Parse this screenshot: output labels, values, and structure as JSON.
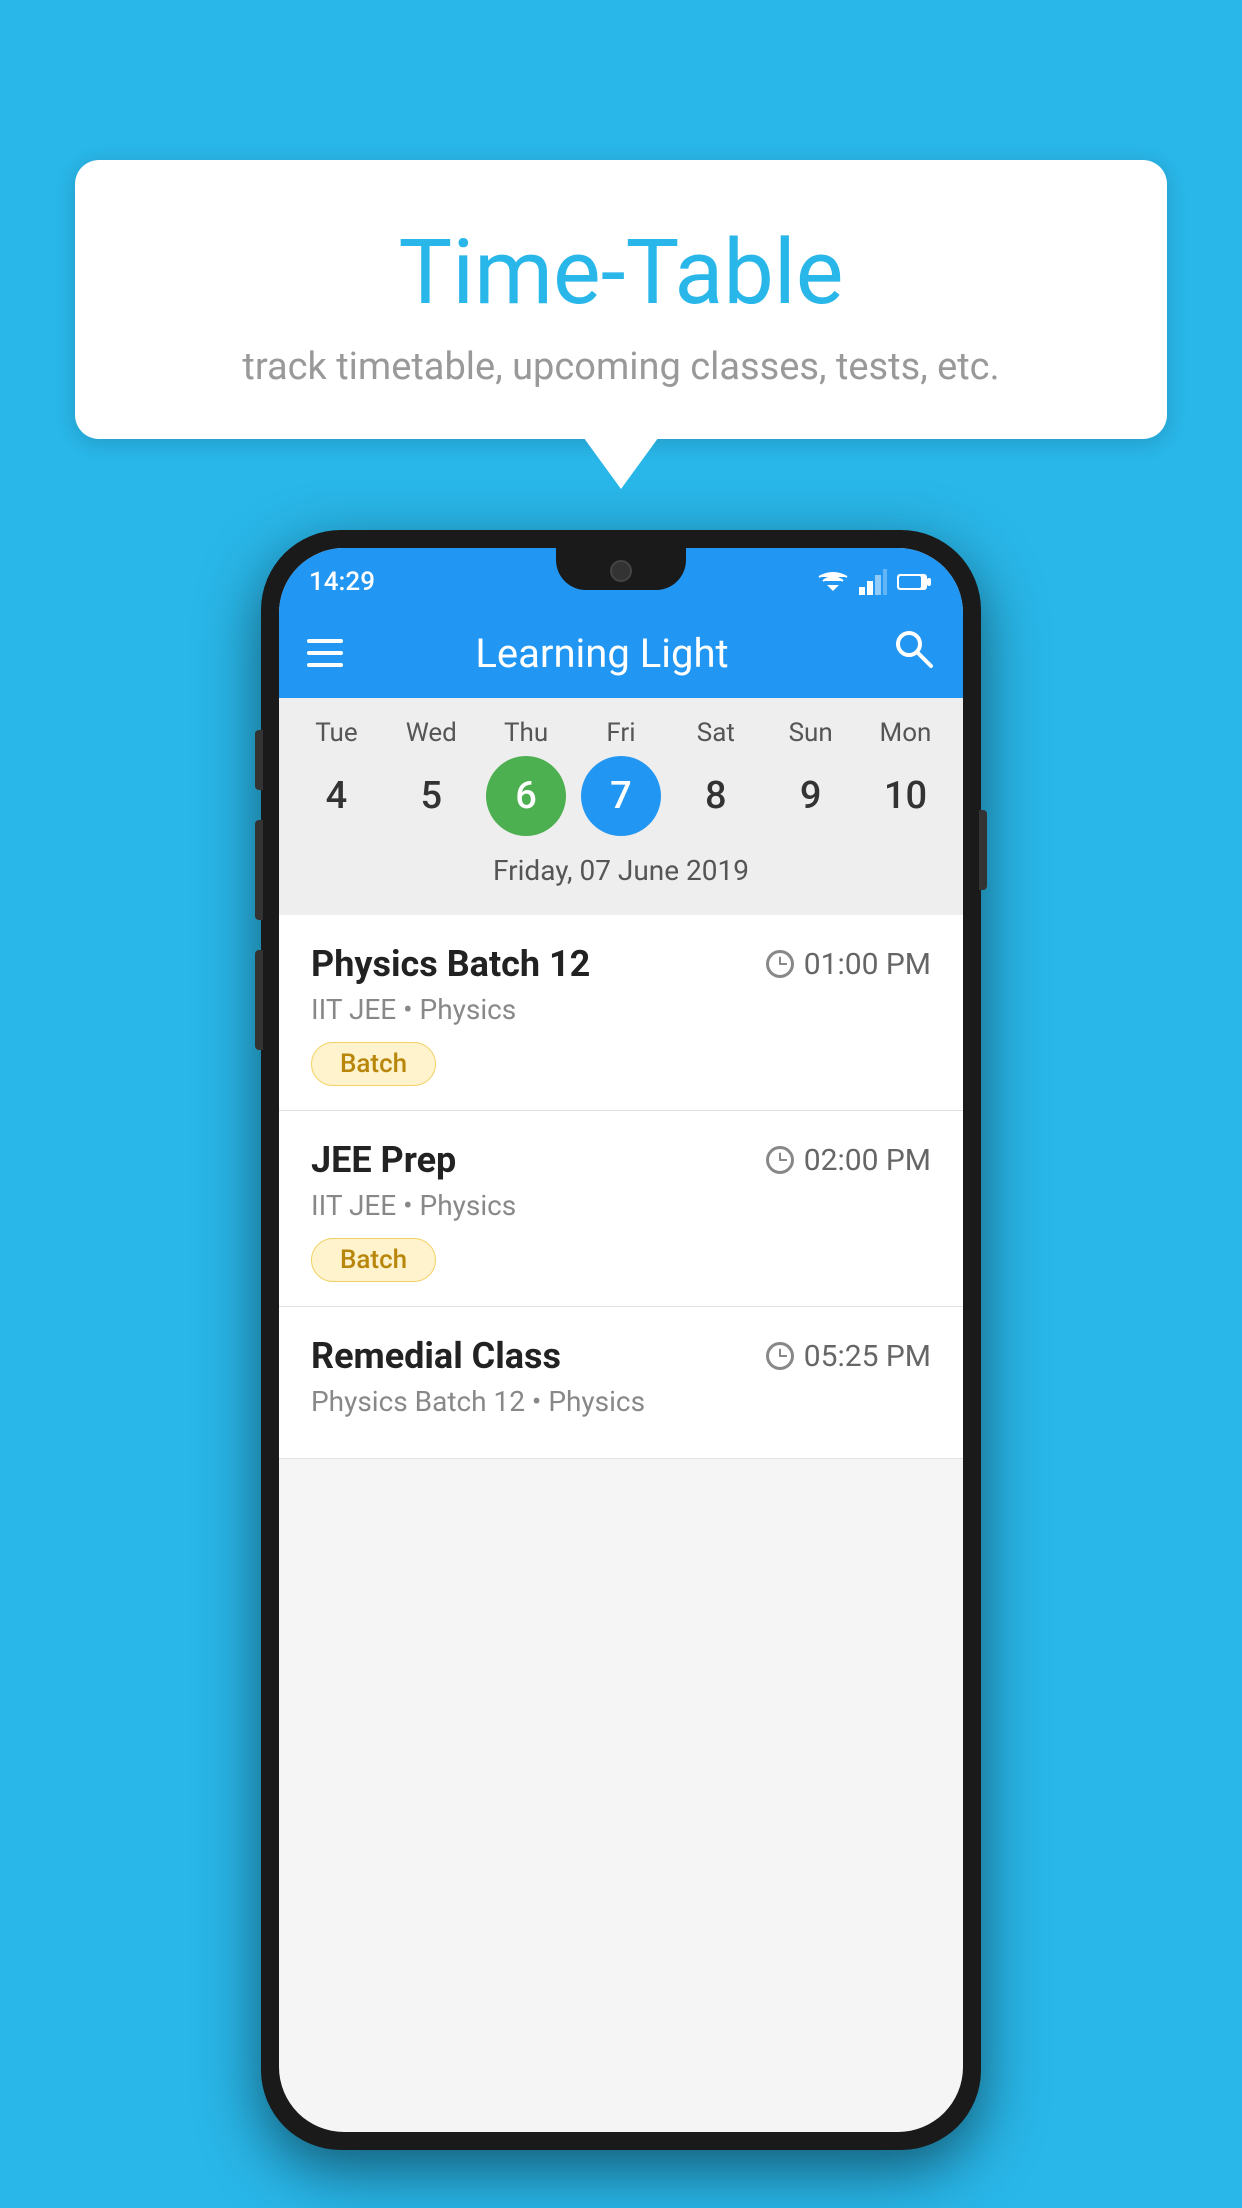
{
  "background_color": "#29B6E8",
  "bubble": {
    "title": "Time-Table",
    "subtitle": "track timetable, upcoming classes, tests, etc."
  },
  "phone": {
    "status_bar": {
      "time": "14:29"
    },
    "app_bar": {
      "title": "Learning Light"
    },
    "calendar": {
      "days": [
        {
          "label": "Tue",
          "number": "4"
        },
        {
          "label": "Wed",
          "number": "5"
        },
        {
          "label": "Thu",
          "number": "6",
          "state": "today"
        },
        {
          "label": "Fri",
          "number": "7",
          "state": "selected"
        },
        {
          "label": "Sat",
          "number": "8"
        },
        {
          "label": "Sun",
          "number": "9"
        },
        {
          "label": "Mon",
          "number": "10"
        }
      ],
      "selected_date": "Friday, 07 June 2019"
    },
    "classes": [
      {
        "name": "Physics Batch 12",
        "time": "01:00 PM",
        "subject": "IIT JEE • Physics",
        "badge": "Batch"
      },
      {
        "name": "JEE Prep",
        "time": "02:00 PM",
        "subject": "IIT JEE • Physics",
        "badge": "Batch"
      },
      {
        "name": "Remedial Class",
        "time": "05:25 PM",
        "subject": "Physics Batch 12 • Physics",
        "badge": null
      }
    ]
  }
}
